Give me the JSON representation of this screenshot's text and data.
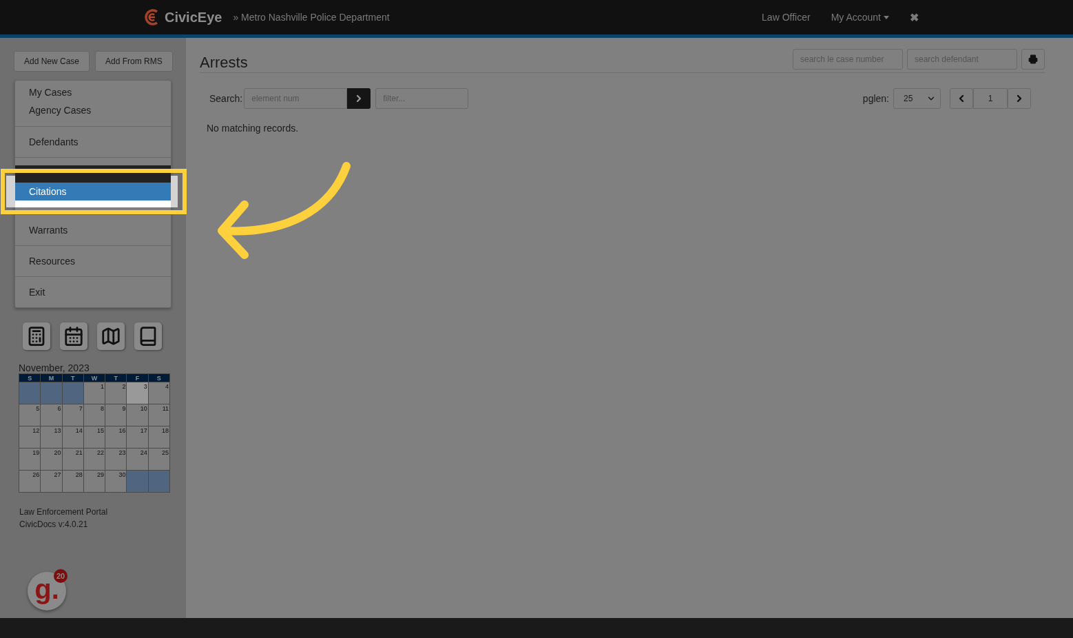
{
  "header": {
    "brand": "CivicEye",
    "subtitle": "» Metro Nashville Police Department",
    "nav": [
      {
        "label": "Law Officer",
        "kind": "link"
      },
      {
        "label": "My Account",
        "kind": "dropdown"
      },
      {
        "label": "✖",
        "kind": "close"
      }
    ]
  },
  "sidebar": {
    "buttons": [
      "Add New Case",
      "Add From RMS"
    ],
    "menu": [
      {
        "kind": "plain",
        "items": [
          {
            "label": "My Cases",
            "selected": false
          },
          {
            "label": "Agency Cases",
            "selected": false
          }
        ]
      },
      {
        "kind": "plain",
        "items": [
          {
            "label": "Defendants",
            "selected": false
          }
        ]
      },
      {
        "kind": "spotlight",
        "items": [
          {
            "label": "Citations",
            "selected": true
          }
        ]
      },
      {
        "kind": "plain",
        "items": [
          {
            "label": "Warrants",
            "selected": false
          }
        ]
      },
      {
        "kind": "plain",
        "items": [
          {
            "label": "Resources",
            "selected": false
          }
        ]
      },
      {
        "kind": "plain",
        "items": [
          {
            "label": "Exit",
            "selected": false
          }
        ]
      }
    ],
    "tools": [
      {
        "kind": "calculator"
      },
      {
        "kind": "calendar"
      },
      {
        "kind": "map"
      },
      {
        "kind": "book"
      }
    ],
    "calendar": {
      "title": "November, 2023",
      "weekdays": [
        "S",
        "M",
        "T",
        "W",
        "T",
        "F",
        "S"
      ],
      "weeks": [
        [
          {
            "kind": "blank"
          },
          {
            "kind": "blank"
          },
          {
            "kind": "blank"
          },
          {
            "kind": "day",
            "day": "1",
            "today": false
          },
          {
            "kind": "day",
            "day": "2",
            "today": false
          },
          {
            "kind": "day",
            "day": "3",
            "today": true
          },
          {
            "kind": "day",
            "day": "4",
            "today": false
          }
        ],
        [
          {
            "kind": "day",
            "day": "5",
            "today": false
          },
          {
            "kind": "day",
            "day": "6",
            "today": false
          },
          {
            "kind": "day",
            "day": "7",
            "today": false
          },
          {
            "kind": "day",
            "day": "8",
            "today": false
          },
          {
            "kind": "day",
            "day": "9",
            "today": false
          },
          {
            "kind": "day",
            "day": "10",
            "today": false
          },
          {
            "kind": "day",
            "day": "11",
            "today": false
          }
        ],
        [
          {
            "kind": "day",
            "day": "12",
            "today": false
          },
          {
            "kind": "day",
            "day": "13",
            "today": false
          },
          {
            "kind": "day",
            "day": "14",
            "today": false
          },
          {
            "kind": "day",
            "day": "15",
            "today": false
          },
          {
            "kind": "day",
            "day": "16",
            "today": false
          },
          {
            "kind": "day",
            "day": "17",
            "today": false
          },
          {
            "kind": "day",
            "day": "18",
            "today": false
          }
        ],
        [
          {
            "kind": "day",
            "day": "19",
            "today": false
          },
          {
            "kind": "day",
            "day": "20",
            "today": false
          },
          {
            "kind": "day",
            "day": "21",
            "today": false
          },
          {
            "kind": "day",
            "day": "22",
            "today": false
          },
          {
            "kind": "day",
            "day": "23",
            "today": false
          },
          {
            "kind": "day",
            "day": "24",
            "today": false
          },
          {
            "kind": "day",
            "day": "25",
            "today": false
          }
        ],
        [
          {
            "kind": "day",
            "day": "26",
            "today": false
          },
          {
            "kind": "day",
            "day": "27",
            "today": false
          },
          {
            "kind": "day",
            "day": "28",
            "today": false
          },
          {
            "kind": "day",
            "day": "29",
            "today": false
          },
          {
            "kind": "day",
            "day": "30",
            "today": false
          },
          {
            "kind": "blank"
          },
          {
            "kind": "blank"
          }
        ]
      ]
    },
    "footer_lines": [
      "Law Enforcement Portal",
      "CivicDocs v:4.0.21"
    ],
    "badge": {
      "logo": "g.",
      "count": "20"
    }
  },
  "main": {
    "title": "Arrests",
    "case_search": {
      "placeholder": "search le case number"
    },
    "defendant_search": {
      "placeholder": "search defendant"
    },
    "toolbar": {
      "search_label": "Search:",
      "element_placeholder": "element num",
      "filter_placeholder": "filter...",
      "pglen_label": "pglen:",
      "pglen": "25",
      "page": "1"
    },
    "message": "No matching records."
  }
}
